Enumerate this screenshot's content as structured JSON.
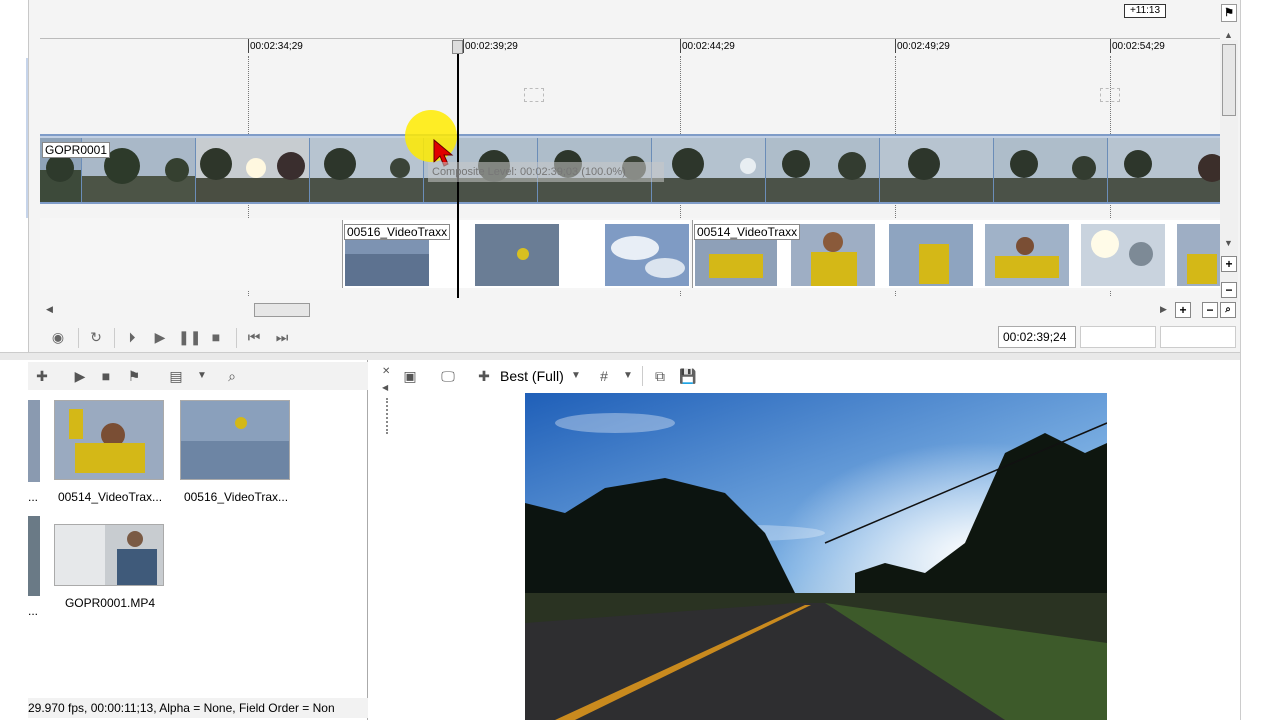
{
  "timeline": {
    "duration_badge": "+11:13",
    "ruler_labels": [
      "00:02:34;29",
      "00:02:39;29",
      "00:02:44;29",
      "00:02:49;29",
      "00:02:54;29"
    ],
    "track1": {
      "clip_label": "GOPR0001"
    },
    "track2": {
      "clip_labels": [
        "00516_VideoTraxx",
        "00514_VideoTraxx"
      ]
    },
    "tooltip": "Composite Level: 00:02:39;03 (100.0%)",
    "current_time": "00:02:39;24"
  },
  "transport": {
    "buttons": [
      "record",
      "loop",
      "play-from-start",
      "play",
      "pause",
      "stop",
      "previous-frame",
      "next-frame"
    ]
  },
  "media": {
    "items": [
      {
        "name": "00514_VideoTrax..."
      },
      {
        "name": "00516_VideoTrax..."
      },
      {
        "name": "GOPR0001.MP4"
      }
    ],
    "partial_items": [
      "...",
      "..."
    ],
    "status": "29.970 fps, 00:00:11;13, Alpha = None, Field Order = Non"
  },
  "preview": {
    "quality": "Best (Full)"
  },
  "colors": {
    "track_highlight": "#c2d0e4",
    "track_border": "#7f9cc8",
    "cursor_highlight": "#ffeb00",
    "cursor": "#e00000"
  }
}
